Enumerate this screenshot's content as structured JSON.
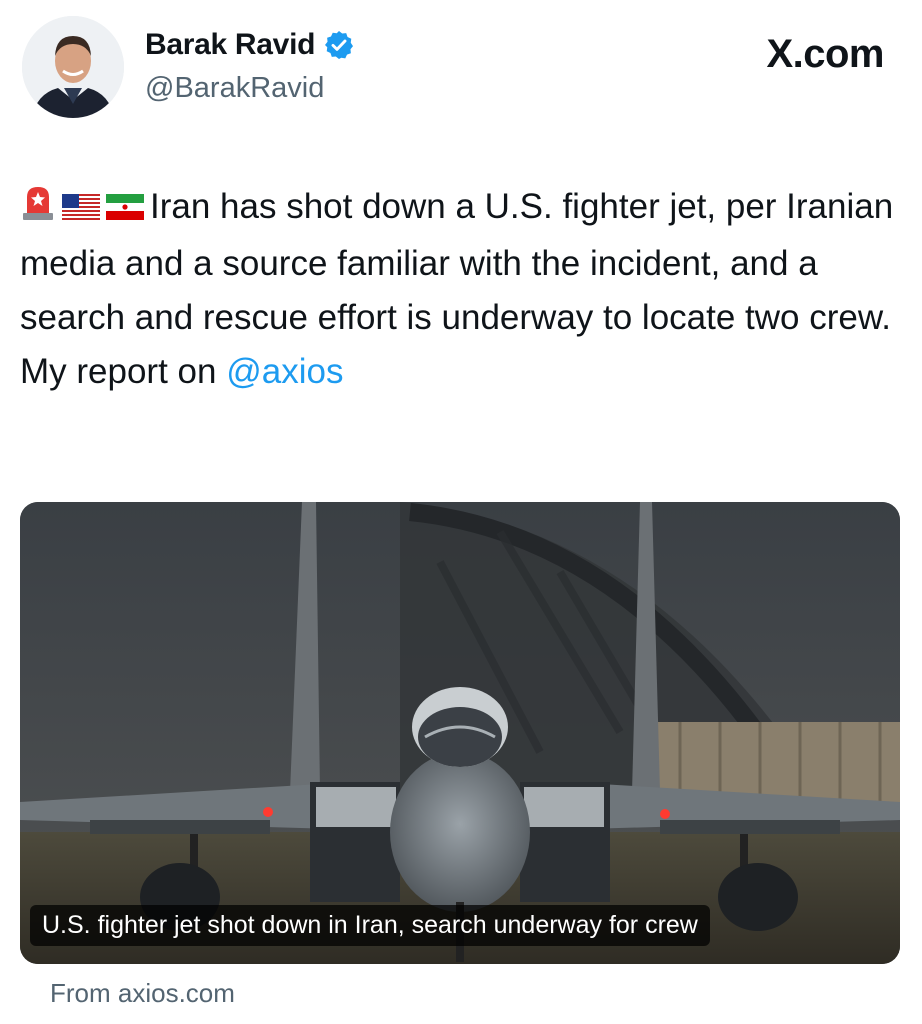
{
  "author": {
    "display_name": "Barak Ravid",
    "handle": "@BarakRavid",
    "verified_icon": "verified-badge-icon",
    "avatar_icon": "profile-photo"
  },
  "brand": {
    "label": "X.com"
  },
  "tweet": {
    "emojis": [
      "rotating-light-icon",
      "us-flag-icon",
      "iran-flag-icon"
    ],
    "body": "Iran has shot down a U.S. fighter jet, per Iranian media and a source familiar with the incident, and a search and rescue effort is underway to locate two crew. My report on ",
    "mention": "@axios"
  },
  "link_card": {
    "caption": "U.S. fighter jet shot down in Iran, search underway for crew",
    "image": "fighter-jet-photo",
    "source": "From axios.com"
  },
  "colors": {
    "accent": "#1d9bf0",
    "text": "#0f1419",
    "muted": "#536471"
  }
}
